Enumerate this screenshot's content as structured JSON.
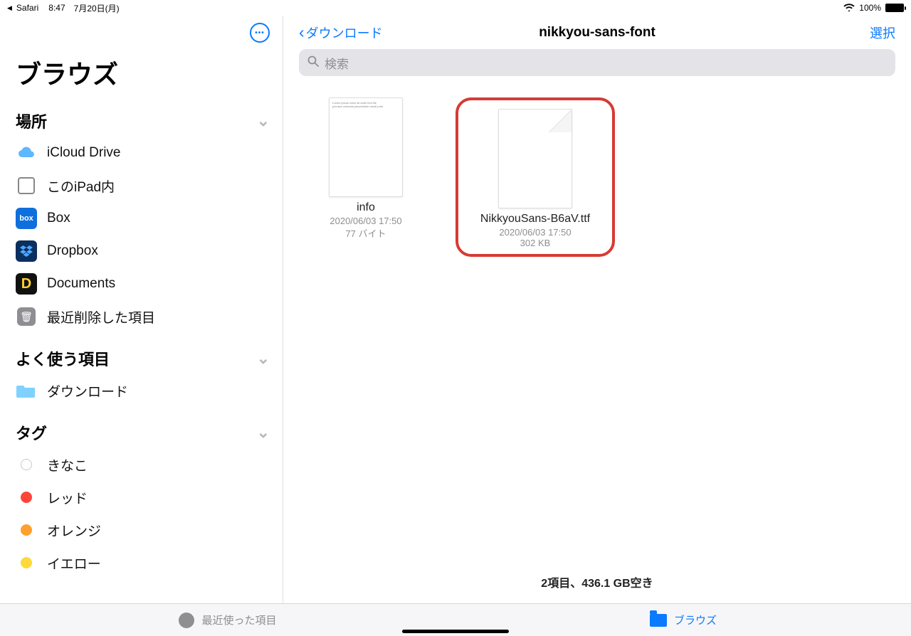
{
  "status": {
    "back_app": "Safari",
    "time": "8:47",
    "date": "7月20日(月)",
    "battery": "100%"
  },
  "sidebar": {
    "title": "ブラウズ",
    "sections": {
      "locations": "場所",
      "favorites": "よく使う項目",
      "tags": "タグ"
    },
    "locations": [
      {
        "label": "iCloud Drive"
      },
      {
        "label": "このiPad内"
      },
      {
        "label": "Box"
      },
      {
        "label": "Dropbox"
      },
      {
        "label": "Documents"
      },
      {
        "label": "最近削除した項目"
      }
    ],
    "favorites": [
      {
        "label": "ダウンロード"
      }
    ],
    "tags": [
      {
        "label": "きなこ",
        "color": "#ffffff",
        "border": "#c9c9cc"
      },
      {
        "label": "レッド",
        "color": "#ff4539",
        "border": "#ff4539"
      },
      {
        "label": "オレンジ",
        "color": "#ff9f2e",
        "border": "#ff9f2e"
      },
      {
        "label": "イエロー",
        "color": "#ffd93a",
        "border": "#ffd93a"
      }
    ]
  },
  "main": {
    "back_label": "ダウンロード",
    "title": "nikkyou-sans-font",
    "select_label": "選択",
    "search_placeholder": "検索",
    "files": [
      {
        "name": "info",
        "date": "2020/06/03 17:50",
        "size": "77 バイト",
        "highlight": false,
        "kind": "text"
      },
      {
        "name": "NikkyouSans-B6aV.ttf",
        "date": "2020/06/03 17:50",
        "size": "302 KB",
        "highlight": true,
        "kind": "file"
      }
    ],
    "status_line": "2項目、436.1 GB空き"
  },
  "tabs": {
    "recents": "最近使った項目",
    "browse": "ブラウズ"
  }
}
